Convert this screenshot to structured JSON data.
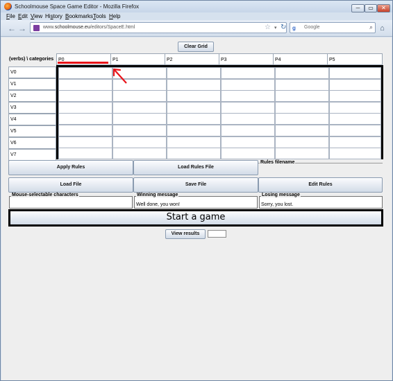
{
  "window": {
    "title": "Schoolmouse Space Game Editor - Mozilla Firefox",
    "minimize_label": "─",
    "maximize_label": "▭",
    "close_label": "✕"
  },
  "menu": [
    {
      "u": "F",
      "rest": "ile"
    },
    {
      "u": "E",
      "rest": "dit"
    },
    {
      "u": "V",
      "rest": "iew"
    },
    {
      "u": "",
      "rest": "Hi",
      "u2": "s",
      "rest2": "tory"
    },
    {
      "u": "B",
      "rest": "ookmarks"
    },
    {
      "u": "T",
      "rest": "ools"
    },
    {
      "u": "H",
      "rest": "elp"
    }
  ],
  "navbar": {
    "back_icon": "←",
    "forward_icon": "→",
    "url_prefix": "www.",
    "url_domain": "schoolmouse.eu",
    "url_path": "/editors/SpaceE.html",
    "star_icon": "☆",
    "drop_icon": "▾",
    "reload_icon": "↻",
    "search_engine_icon": "g",
    "search_placeholder": "Google",
    "search_icon": "⌕",
    "home_icon": "⌂"
  },
  "editor": {
    "clear_grid_label": "Clear Grid",
    "corner_label": "(verbs) \\ categories",
    "columns": [
      "P0",
      "P1",
      "P2",
      "P3",
      "P4",
      "P5"
    ],
    "rows": [
      "V0",
      "V1",
      "V2",
      "V3",
      "V4",
      "V5",
      "V6",
      "V7"
    ],
    "apply_rules_label": "Apply Rules",
    "load_rules_file_label": "Load Rules File",
    "rules_filename_legend": "Rules filename",
    "rules_filename_value": "",
    "load_file_label": "Load File",
    "save_file_label": "Save File",
    "edit_rules_label": "Edit Rules",
    "mouse_chars_legend": "Mouse-selectable characters",
    "mouse_chars_value": "",
    "winning_legend": "Winning message",
    "winning_value": "Well done, you won!",
    "losing_legend": "Losing message",
    "losing_value": "Sorry, you lost.",
    "start_game_label": "Start a game",
    "view_results_label": "View results",
    "results_value": ""
  },
  "colors": {
    "annotation": "#e8141a",
    "grid_border": "#000000"
  }
}
